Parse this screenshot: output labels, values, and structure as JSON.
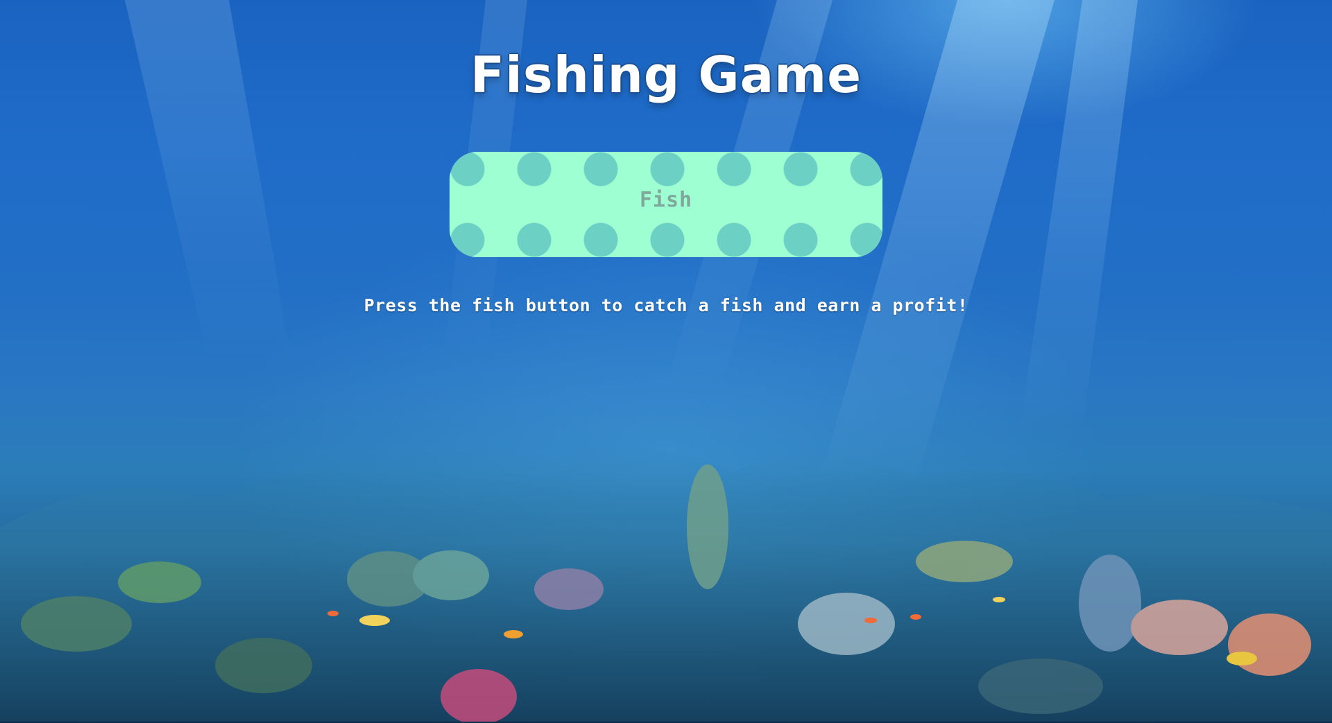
{
  "title": "Fishing Game",
  "fish_button": {
    "label": "Fish"
  },
  "instructions": "Press the fish button to catch a fish and earn a profit!",
  "colors": {
    "button_fill": "#9effd3",
    "button_dots": "#6cd0c4",
    "button_text": "#7fa79a",
    "title_text": "#ffffff",
    "ocean_top": "#1b63c0",
    "ocean_bottom": "#143c5f"
  }
}
